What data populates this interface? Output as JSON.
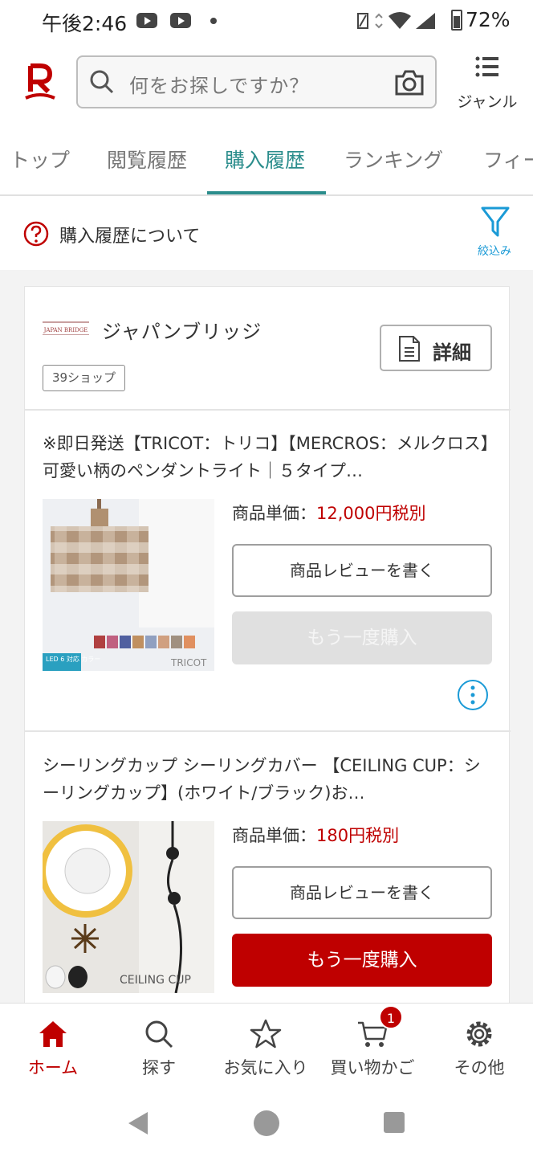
{
  "status_bar": {
    "time": "午後2:46",
    "battery": "72%"
  },
  "header": {
    "search_placeholder": "何をお探しですか？",
    "genre_label": "ジャンル"
  },
  "tabs": [
    {
      "label": "トップ"
    },
    {
      "label": "閲覧履歴"
    },
    {
      "label": "購入履歴"
    },
    {
      "label": "ランキング"
    },
    {
      "label": "フィー"
    }
  ],
  "active_tab": "購入履歴",
  "about": {
    "text": "購入履歴について",
    "filter_label": "絞込み"
  },
  "shop": {
    "logo_text": "JAPAN BRIDGE",
    "name": "ジャパンブリッジ",
    "badge": "39ショップ",
    "detail_label": "詳細"
  },
  "items": [
    {
      "title": "※即日発送【TRICOT：トリコ】【MERCROS：メルクロス】可愛い柄のペンダントライト｜５タイプ…",
      "price_label": "商品単価：",
      "price_value": "12,000円税別",
      "review_label": "商品レビューを書く",
      "rebuy_label": "もう一度購入",
      "rebuy_enabled": false,
      "image_text": "TRICOT",
      "image_badge": "LED 6 対応 カラー"
    },
    {
      "title": "シーリングカップ シーリングカバー 【CEILING CUP：シーリングカップ】(ホワイト/ブラック)お…",
      "price_label": "商品単価：",
      "price_value": "180円税別",
      "review_label": "商品レビューを書く",
      "rebuy_label": "もう一度購入",
      "rebuy_enabled": true,
      "image_text": "CEILING CUP"
    }
  ],
  "bottom_nav": [
    {
      "label": "ホーム",
      "icon": "home-icon",
      "active": true
    },
    {
      "label": "探す",
      "icon": "search-icon"
    },
    {
      "label": "お気に入り",
      "icon": "star-icon"
    },
    {
      "label": "買い物かご",
      "icon": "cart-icon",
      "badge": "1"
    },
    {
      "label": "その他",
      "icon": "gear-icon"
    }
  ],
  "colors": {
    "brand_red": "#bf0000",
    "accent_teal": "#2b8d8c",
    "filter_blue": "#1a9ad6"
  }
}
